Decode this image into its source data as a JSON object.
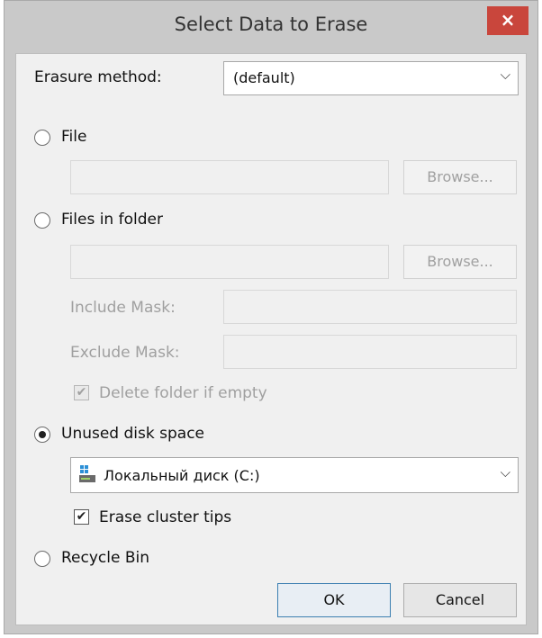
{
  "window": {
    "title": "Select Data to Erase",
    "close_glyph": "×"
  },
  "erasure_method": {
    "label": "Erasure method:",
    "value": "(default)"
  },
  "file": {
    "label": "File",
    "selected": false,
    "path_value": "",
    "browse_label": "Browse..."
  },
  "folder": {
    "label": "Files in folder",
    "selected": false,
    "path_value": "",
    "browse_label": "Browse...",
    "include_mask_label": "Include Mask:",
    "include_mask_value": "",
    "exclude_mask_label": "Exclude Mask:",
    "exclude_mask_value": "",
    "delete_if_empty_label": "Delete folder if empty",
    "delete_if_empty_checked": true
  },
  "unused_space": {
    "label": "Unused disk space",
    "selected": true,
    "drive_value": "Локальный диск (C:)",
    "drive_icon": "drive-icon",
    "erase_cluster_tips_label": "Erase cluster tips",
    "erase_cluster_tips_checked": true
  },
  "recycle_bin": {
    "label": "Recycle Bin",
    "selected": false
  },
  "buttons": {
    "ok_label": "OK",
    "cancel_label": "Cancel"
  },
  "colors": {
    "close_button": "#c9463c",
    "default_button_border": "#3c7fb1",
    "drive_icon": "#2b8fd6"
  }
}
